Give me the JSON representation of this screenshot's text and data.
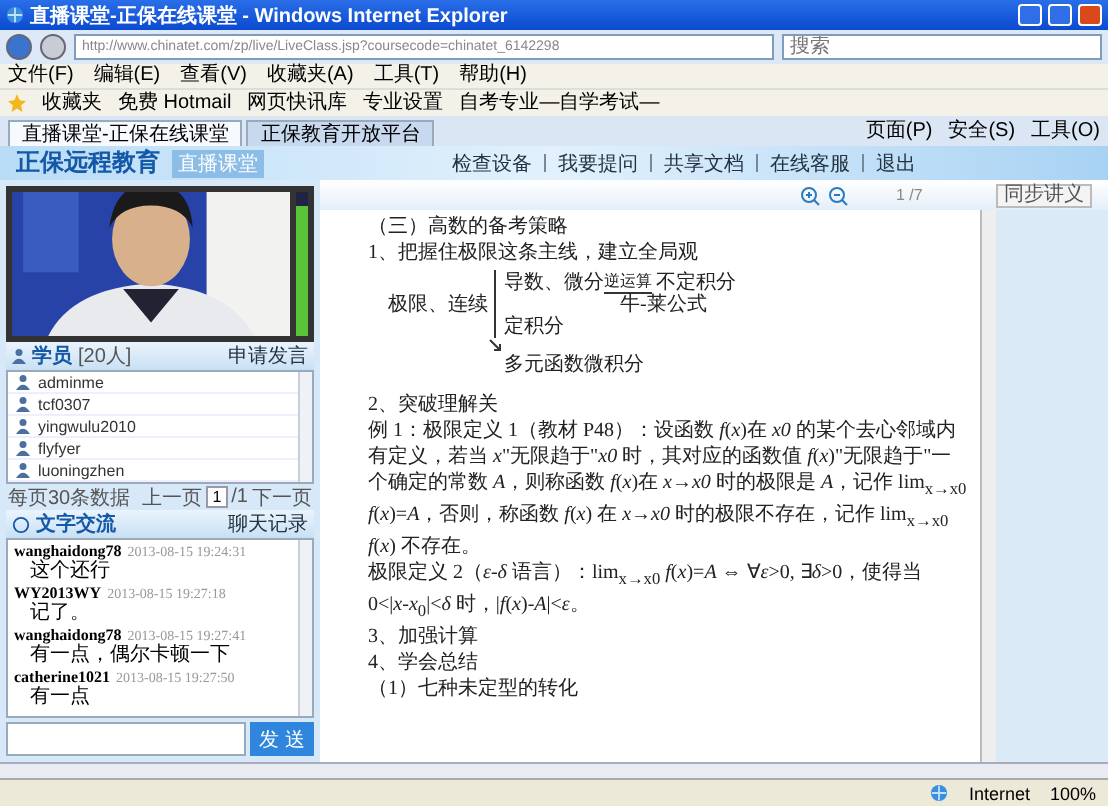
{
  "window": {
    "title": "直播课堂-正保在线课堂 - Windows Internet Explorer"
  },
  "address_bar": {
    "url": "http://www.chinatet.com/zp/live/LiveClass.jsp?coursecode=chinatet_6142298",
    "search_placeholder": "搜索"
  },
  "menu": [
    "文件(F)",
    "编辑(E)",
    "查看(V)",
    "收藏夹(A)",
    "工具(T)",
    "帮助(H)"
  ],
  "favorites": [
    "收藏夹",
    "免费 Hotmail",
    "网页快讯库",
    "专业设置",
    "自考专业—自学考试—"
  ],
  "tabs": [
    {
      "label": "直播课堂-正保在线课堂",
      "selected": true
    },
    {
      "label": "正保教育开放平台",
      "selected": false
    }
  ],
  "command_bar": [
    "页面(P)",
    "安全(S)",
    "工具(O)"
  ],
  "site": {
    "logo": "正保远程教育",
    "subtitle": "直播课堂",
    "nav": [
      "检查设备",
      "我要提问",
      "共享文档",
      "在线客服",
      "退出"
    ]
  },
  "video": {
    "volume": {
      "level": 0.9
    }
  },
  "students": {
    "title": "学员",
    "count": "[20人]",
    "action": "申请发言",
    "items": [
      "adminme",
      "tcf0307",
      "yingwulu2010",
      "flyfyer",
      "luoningzhen"
    ],
    "pager": {
      "info": "每页30条数据",
      "prev": "上一页",
      "page": "1",
      "total": "/1",
      "next": "下一页"
    }
  },
  "chat": {
    "title": "文字交流",
    "history": "聊天记录",
    "send": "发 送",
    "messages": [
      {
        "user": "wanghaidong78",
        "time": "2013-08-15 19:24:31",
        "text": "这个还行"
      },
      {
        "user": "WY2013WY",
        "time": "2013-08-15 19:27:18",
        "text": "记了。"
      },
      {
        "user": "wanghaidong78",
        "time": "2013-08-15 19:27:41",
        "text": "有一点，偶尔卡顿一下"
      },
      {
        "user": "catherine1021",
        "time": "2013-08-15 19:27:50",
        "text": "有一点"
      }
    ]
  },
  "document": {
    "page": "1 /7",
    "sync": "同步讲义",
    "blocks": [
      {
        "kind": "heading",
        "text": "（三）高数的备考策略"
      },
      {
        "kind": "heading",
        "text": "1、把握住极限这条主线，建立全局观"
      },
      {
        "kind": "diagram",
        "root": "极限、连续",
        "branch1": "导数、微分",
        "arrow_label": "逆运算",
        "target": "不定积分",
        "link": "牛-莱公式",
        "branch2": "定积分",
        "bottom": "多元函数微积分"
      },
      {
        "kind": "heading",
        "text": "2、突破理解关"
      },
      {
        "kind": "para",
        "text": "例 1：极限定义 1（教材 P48）：设函数 *f*(*x*)在 *x0* 的某个去心邻域内有定义，若当 *x*\"无限趋于\"*x0* 时，其对应的函数值 *f*(*x*)\"无限趋于\"一个确定的常数 *A*，则称函数 *f*(*x*)在 *x*→*x0* 时的极限是 *A*，记作 lim$_{x→x0}$ *f*(*x*)=*A*，否则，称函数 *f*(*x*) 在 *x*→*x0* 时的极限不存在，记作 lim$_{x→x0}$ *f*(*x*) 不存在。"
      },
      {
        "kind": "para",
        "text": "极限定义 2（*ε*-*δ* 语言）：lim$_{x→x0}$ *f*(*x*)=*A* ⇔ ∀*ε*>0, ∃*δ*>0，使得当 0<|*x*-*x*$_{0}$|<*δ* 时，|*f*(*x*)-*A*|<*ε*。"
      },
      {
        "kind": "heading",
        "text": "3、加强计算"
      },
      {
        "kind": "heading",
        "text": "4、学会总结"
      },
      {
        "kind": "heading",
        "text": "（1）七种未定型的转化"
      }
    ]
  },
  "status_bar": {
    "zone": "Internet",
    "zoom": "100%"
  }
}
